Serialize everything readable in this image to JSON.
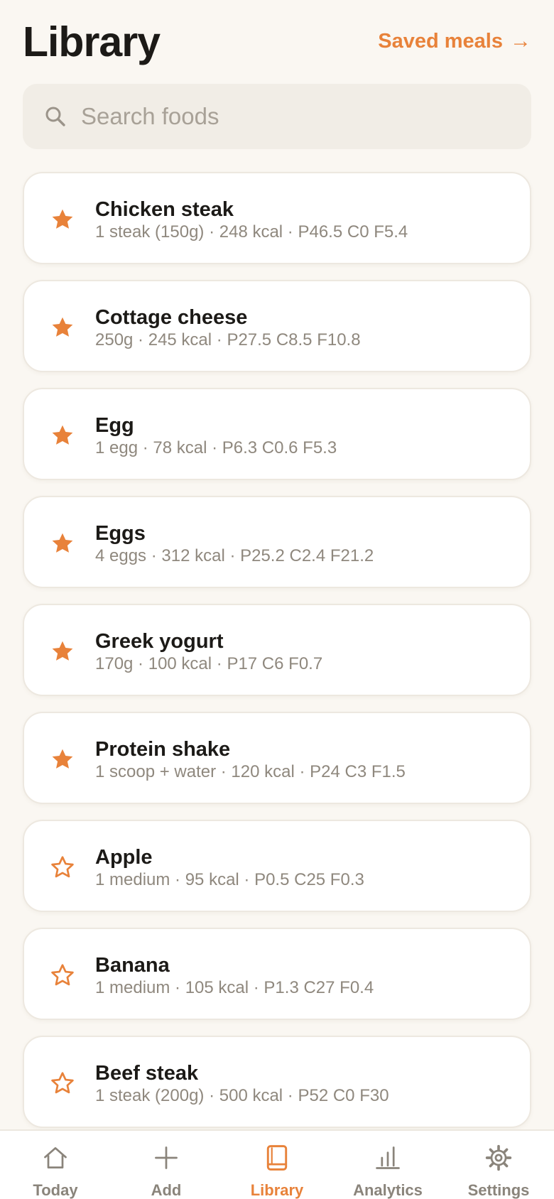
{
  "header": {
    "title": "Library",
    "saved_meals_label": "Saved meals",
    "saved_meals_arrow": "→"
  },
  "search": {
    "placeholder": "Search foods",
    "value": ""
  },
  "foods": [
    {
      "name": "Chicken steak",
      "meta": "1 steak (150g) · 248 kcal · P46.5 C0 F5.4",
      "favorite": true
    },
    {
      "name": "Cottage cheese",
      "meta": "250g · 245 kcal · P27.5 C8.5 F10.8",
      "favorite": true
    },
    {
      "name": "Egg",
      "meta": "1 egg · 78 kcal · P6.3 C0.6 F5.3",
      "favorite": true
    },
    {
      "name": "Eggs",
      "meta": "4 eggs · 312 kcal · P25.2 C2.4 F21.2",
      "favorite": true
    },
    {
      "name": "Greek yogurt",
      "meta": "170g · 100 kcal · P17 C6 F0.7",
      "favorite": true
    },
    {
      "name": "Protein shake",
      "meta": "1 scoop + water · 120 kcal · P24 C3 F1.5",
      "favorite": true
    },
    {
      "name": "Apple",
      "meta": "1 medium · 95 kcal · P0.5 C25 F0.3",
      "favorite": false
    },
    {
      "name": "Banana",
      "meta": "1 medium · 105 kcal · P1.3 C27 F0.4",
      "favorite": false
    },
    {
      "name": "Beef steak",
      "meta": "1 steak (200g) · 500 kcal · P52 C0 F30",
      "favorite": false
    }
  ],
  "tabs": [
    {
      "label": "Today",
      "icon": "house-icon",
      "active": false
    },
    {
      "label": "Add",
      "icon": "plus-icon",
      "active": false
    },
    {
      "label": "Library",
      "icon": "book-icon",
      "active": true
    },
    {
      "label": "Analytics",
      "icon": "bar-chart-icon",
      "active": false
    },
    {
      "label": "Settings",
      "icon": "gear-icon",
      "active": false
    }
  ],
  "colors": {
    "accent": "#e8823a",
    "background": "#faf7f2",
    "text": "#1c1a17",
    "muted": "#8f887e"
  }
}
